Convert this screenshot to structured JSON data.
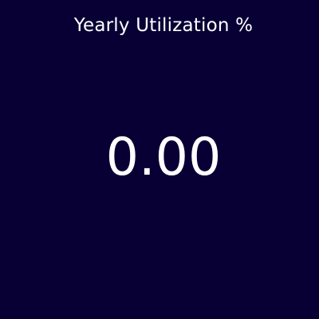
{
  "widget": {
    "title": "Yearly Utilization %",
    "value": "0.00",
    "background_color": "#080035",
    "text_color": "#ffffff"
  }
}
